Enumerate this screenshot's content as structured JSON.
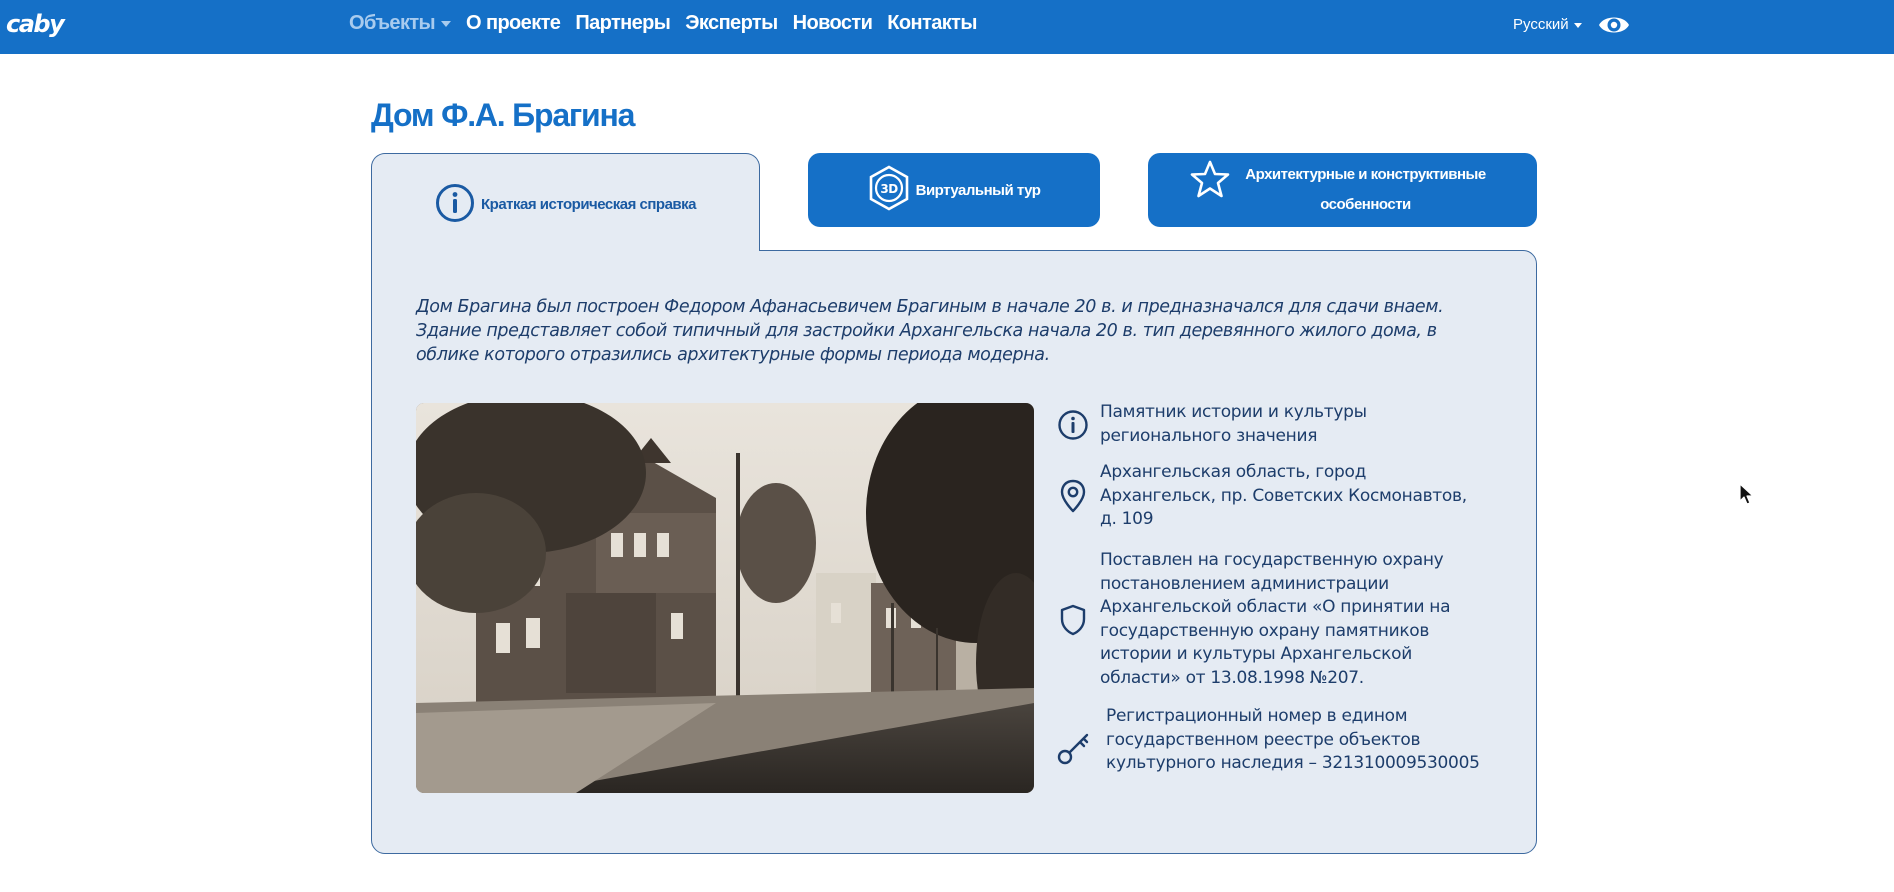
{
  "navbar": {
    "logo": "caby",
    "items": [
      {
        "label": "Объекты",
        "dropdown": true,
        "active": true
      },
      {
        "label": "О проекте"
      },
      {
        "label": "Партнеры"
      },
      {
        "label": "Эксперты"
      },
      {
        "label": "Новости"
      },
      {
        "label": "Контакты"
      }
    ],
    "language": "Русский",
    "accessibility_icon": "eye-icon"
  },
  "page": {
    "title": "Дом Ф.А. Брагина"
  },
  "tabs": {
    "info": {
      "label": "Краткая историческая справка",
      "icon": "info-icon",
      "active": true
    },
    "tour": {
      "label": "Виртуальный тур",
      "icon": "3d-icon"
    },
    "arch": {
      "label": "Архитектурные и конструктивные особенности",
      "icon": "star-icon"
    }
  },
  "content": {
    "intro": "Дом Брагина был построен Федором Афанасьевичем Брагиным в начале 20 в. и предназначался для сдачи внаем. Здание представляет собой типичный для застройки Архангельска начала 20 в. тип деревянного жилого дома, в облике которого отразились архитектурные формы периода модерна.",
    "facts": [
      {
        "icon": "info-icon",
        "text": "Памятник истории и культуры регионального значения"
      },
      {
        "icon": "map-pin-icon",
        "text": "Архангельская область, город Архангельск, пр. Советских Космонавтов, д. 109"
      },
      {
        "icon": "shield-icon",
        "text": "Поставлен на государственную охрану постановлением администрации Архангельской области «О принятии на государственную охрану памятников истории и культуры Архангельской области» от 13.08.1998 №207."
      },
      {
        "icon": "key-icon",
        "text": "Регистрационный номер в едином государственном реестре объектов культурного наследия – 321310009530005"
      }
    ]
  },
  "colors": {
    "brand": "#1570c7",
    "panel_bg": "#e5ebf3",
    "border": "#3d6aa0",
    "text": "#1d3d6b"
  }
}
